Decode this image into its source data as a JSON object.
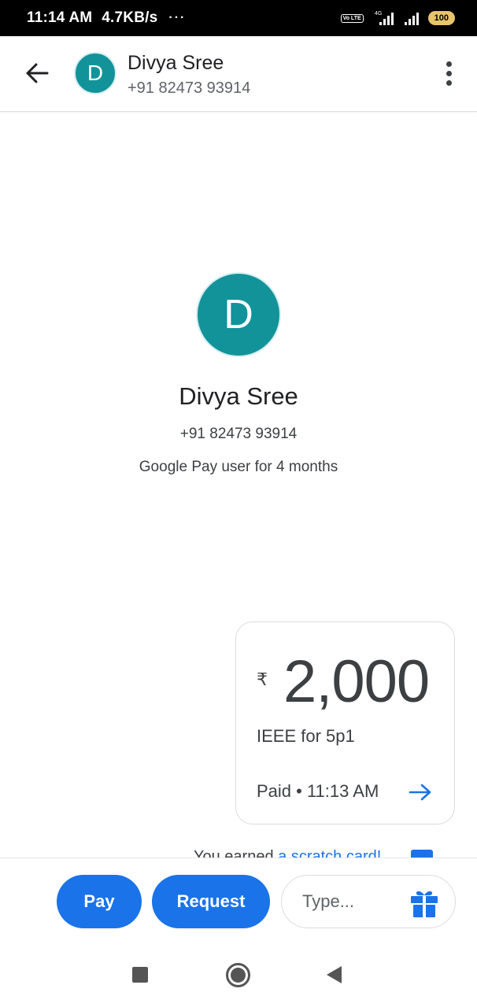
{
  "status_bar": {
    "time": "11:14 AM",
    "speed": "4.7KB/s",
    "dots": "···",
    "volte": "Vo LTE",
    "network": "4G",
    "battery": "100"
  },
  "header": {
    "avatar_initial": "D",
    "name": "Divya Sree",
    "phone": "+91 82473 93914"
  },
  "profile": {
    "avatar_initial": "D",
    "name": "Divya Sree",
    "phone": "+91 82473 93914",
    "user_since": "Google Pay user for 4 months"
  },
  "payment": {
    "currency_symbol": "₹",
    "amount": "2,000",
    "note": "IEEE for 5p1",
    "status": "Paid • 11:13 AM"
  },
  "scratch": {
    "text": "You earned ",
    "link": "a scratch card!"
  },
  "composer": {
    "pay_label": "Pay",
    "request_label": "Request",
    "placeholder": "Type..."
  },
  "colors": {
    "accent": "#1a73e8",
    "avatar": "#12939a"
  },
  "icons": {
    "back": "arrow-left-icon",
    "more": "more-vert-icon",
    "details": "arrow-right-icon",
    "gift": "gift-icon"
  }
}
